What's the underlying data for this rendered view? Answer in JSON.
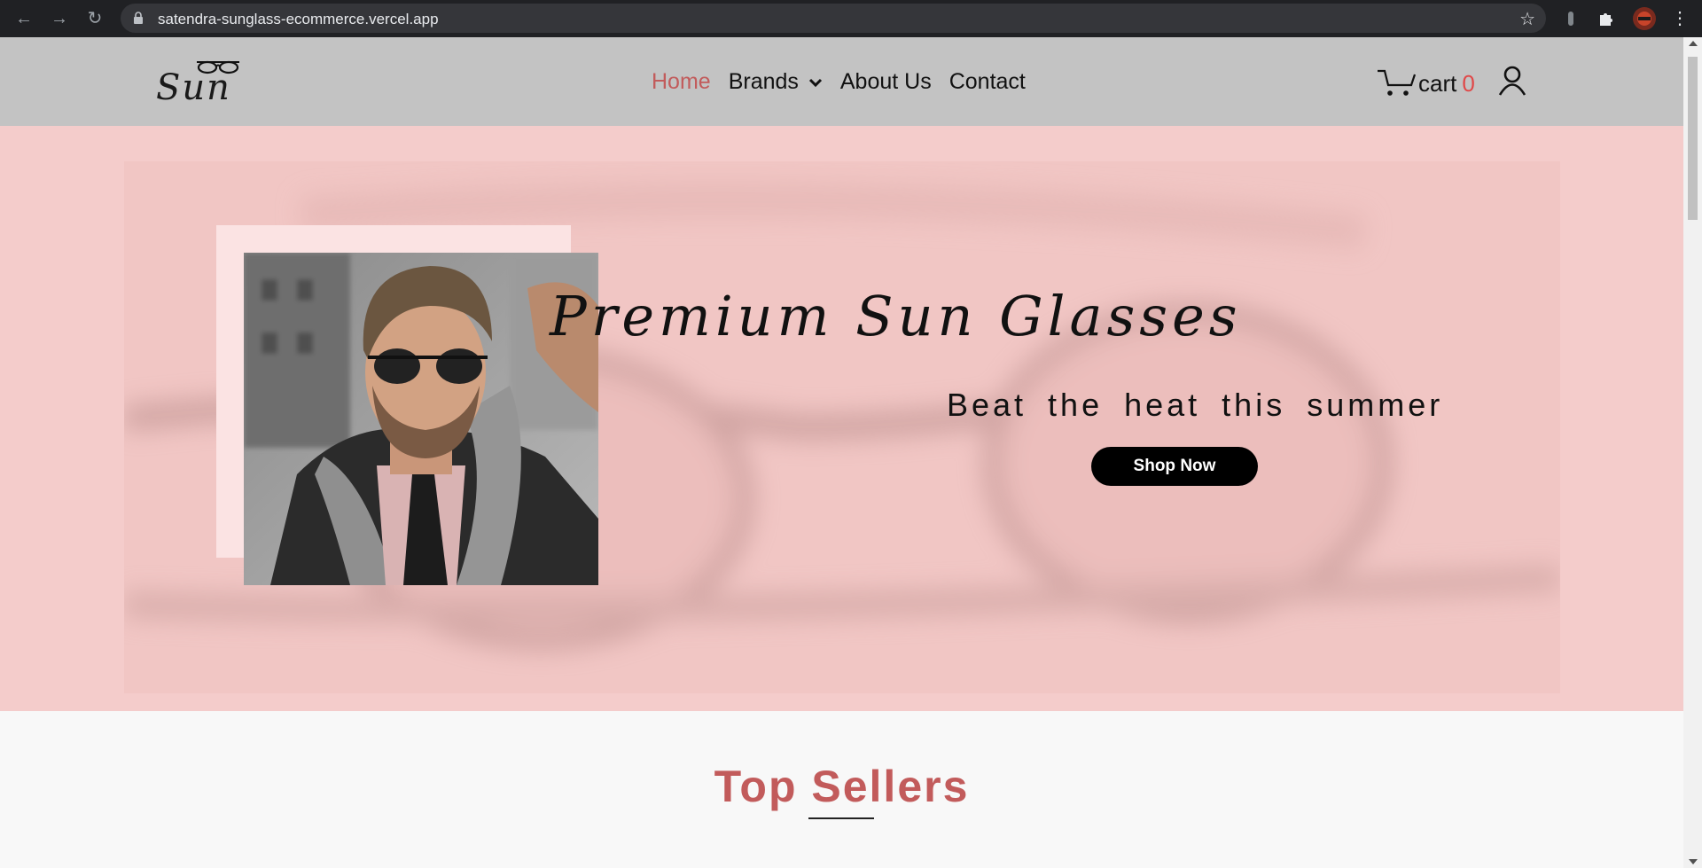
{
  "browser": {
    "url": "satendra-sunglass-ecommerce.vercel.app"
  },
  "header": {
    "logo_text": "Sun",
    "nav": [
      {
        "label": "Home",
        "active": true
      },
      {
        "label": "Brands",
        "dropdown": true
      },
      {
        "label": "About Us"
      },
      {
        "label": "Contact"
      }
    ],
    "cart_label": "cart",
    "cart_count": "0"
  },
  "hero": {
    "title": "Premium Sun Glasses",
    "subtitle": "Beat the heat this summer",
    "cta_label": "Shop Now"
  },
  "top_sellers": {
    "title": "Top Sellers"
  },
  "colors": {
    "accent": "#c25b5b",
    "hero_bg": "#f4cccb",
    "header_bg": "#c3c3c3",
    "cart_count": "#e04848"
  }
}
